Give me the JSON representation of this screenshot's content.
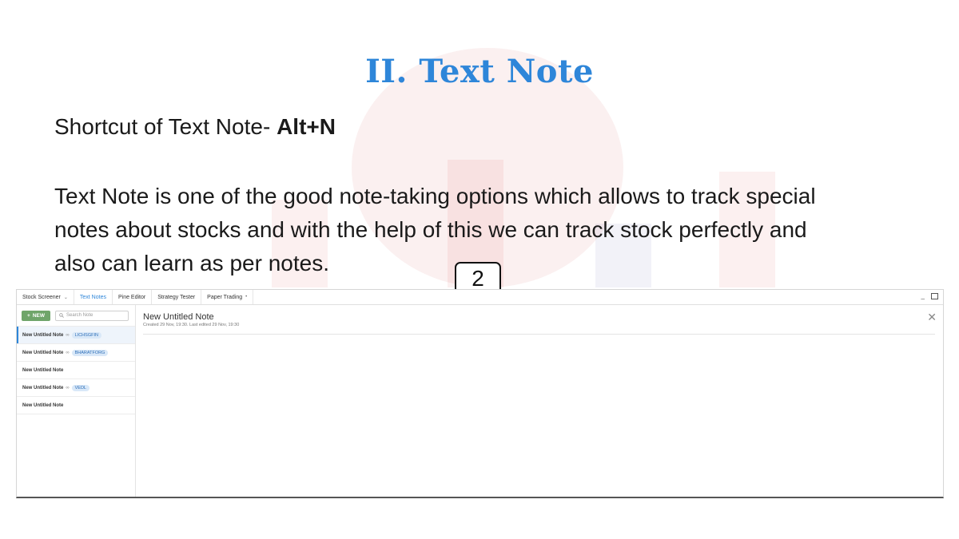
{
  "slide": {
    "title": "II. Text Note",
    "shortcut_prefix": "Shortcut of Text Note- ",
    "shortcut_keys": "Alt+N",
    "description_lines": [
      "Text Note is one of the good note-taking options which allows to track special",
      "notes about stocks and with the help of this we can track stock perfectly and",
      "also can learn as per notes."
    ],
    "step_badge": "2"
  },
  "app": {
    "tabs": [
      {
        "label": "Stock Screener",
        "chevron": "⌄"
      },
      {
        "label": "Text Notes"
      },
      {
        "label": "Pine Editor"
      },
      {
        "label": "Strategy Tester"
      },
      {
        "label": "Paper Trading",
        "chevron": "•"
      }
    ],
    "active_tab": "Text Notes",
    "new_button": "NEW",
    "search_placeholder": "Search Note",
    "notes": [
      {
        "title": "New Untitled Note",
        "tag": "LICHSGFIN"
      },
      {
        "title": "New Untitled Note",
        "tag": "BHARATFORG"
      },
      {
        "title": "New Untitled Note",
        "tag": ""
      },
      {
        "title": "New Untitled Note",
        "tag": "VEDL"
      },
      {
        "title": "New Untitled Note",
        "tag": ""
      }
    ],
    "open_note": {
      "title": "New Untitled Note",
      "meta": "Created 29 Nov, 19:30. Last edited 29 Nov, 19:30"
    }
  },
  "colors": {
    "title": "#2e86d9",
    "new_button": "#6fa56a",
    "active_tab": "#2e86d9"
  }
}
